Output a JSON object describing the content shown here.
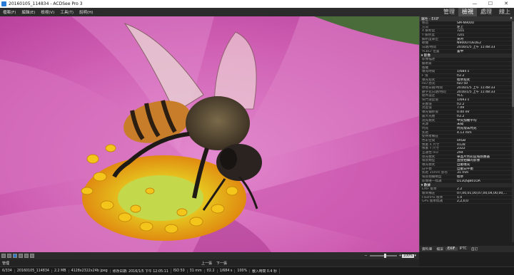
{
  "window": {
    "title": "20160105_114834 - ACDSee Pro 3",
    "min": "—",
    "max": "☐",
    "close": "✕"
  },
  "menu": [
    "檔案(F)",
    "編輯(E)",
    "檢視(V)",
    "工具(T)",
    "說明(H)"
  ],
  "modes": [
    {
      "label": "管理",
      "active": false
    },
    {
      "label": "檢視",
      "active": true
    },
    {
      "label": "處理",
      "active": false
    },
    {
      "label": "線上",
      "active": false
    }
  ],
  "panel": {
    "header": "屬性 - EXIF",
    "close": "✕",
    "rows": [
      {
        "k": "製造",
        "v": "SM-N900U"
      },
      {
        "k": "方向",
        "v": "左上"
      },
      {
        "k": "X 解析度",
        "v": "72/1"
      },
      {
        "k": "Y 解析度",
        "v": "72/1"
      },
      {
        "k": "解析度單位",
        "v": "英吋"
      },
      {
        "k": "軟體",
        "v": "N900UTUEOE2"
      },
      {
        "k": "日期/時間",
        "v": "2016/1/5 上午 11:48:33"
      },
      {
        "k": "YCbCr 位置",
        "v": "置中"
      },
      {
        "sec": "▾ 影像"
      },
      {
        "k": "影像描述",
        "v": ""
      },
      {
        "k": "藝術家",
        "v": ""
      },
      {
        "k": "版權",
        "v": ""
      },
      {
        "k": "曝光時間",
        "v": "1/684 s"
      },
      {
        "k": "F 值",
        "v": "f/2.2"
      },
      {
        "k": "曝光程式",
        "v": "標準程式"
      },
      {
        "k": "ISO 感光",
        "v": "ISO 50"
      },
      {
        "k": "原始日期/時間",
        "v": "2016/1/5 上午 11:48:33"
      },
      {
        "k": "數字化日期/時間",
        "v": "2016/1/5 上午 11:48:33"
      },
      {
        "k": "組件設定",
        "v": "YCC"
      },
      {
        "k": "快門速度值",
        "v": "1/693 s"
      },
      {
        "k": "光圈值",
        "v": "f/2.2"
      },
      {
        "k": "亮度值",
        "v": "7.09"
      },
      {
        "k": "曝光偏移值",
        "v": "0.00 eV"
      },
      {
        "k": "最大光圈",
        "v": "f/2.2"
      },
      {
        "k": "測光模式",
        "v": "中央加權平均"
      },
      {
        "k": "光源",
        "v": "未知"
      },
      {
        "k": "閃光",
        "v": "閃光燈未閃光"
      },
      {
        "k": "焦距",
        "v": "4.13 mm"
      },
      {
        "k": "使用者備註",
        "v": ""
      },
      {
        "k": "色彩空間",
        "v": "sRGB"
      },
      {
        "k": "像素 X 尺寸",
        "v": "4128"
      },
      {
        "k": "像素 Y 尺寸",
        "v": "2322"
      },
      {
        "k": "互通性 IFD",
        "v": "294"
      },
      {
        "k": "感光模式",
        "v": "單晶片色彩區域感應器"
      },
      {
        "k": "場景類型",
        "v": "直接拍攝的影像"
      },
      {
        "k": "曝光模式",
        "v": "自動曝光"
      },
      {
        "k": "白平衡",
        "v": "自動白平衡"
      },
      {
        "k": "焦距 35mm 膠卷",
        "v": "31 mm"
      },
      {
        "k": "場景拍攝類型",
        "v": "標準"
      },
      {
        "k": "影像唯一標識",
        "v": "D13QSJB01OA"
      },
      {
        "sec": "▾ 數據"
      },
      {
        "k": "EXIF 版本",
        "v": "2.2"
      },
      {
        "k": "廠商備註",
        "v": "07,00,01,00,07,00,04,00,00,..."
      },
      {
        "k": "FlashPix 版本",
        "v": "1.0"
      },
      {
        "k": "GPS 版本標識",
        "v": "2,2,0,0"
      }
    ]
  },
  "panel_tabs": [
    {
      "label": "資料庫",
      "active": false
    },
    {
      "label": "檔案",
      "active": false
    },
    {
      "label": "EXIF",
      "active": true
    },
    {
      "label": "IPTC",
      "active": false
    },
    {
      "label": "自訂",
      "active": false
    }
  ],
  "toolbar": {
    "zoom": "100%",
    "fit": "▾"
  },
  "navbar": {
    "back": "管理",
    "prev": "上一張",
    "next": "下一張"
  },
  "status": [
    "6/334",
    "20160105_114834",
    "2.2 MB",
    "4128x2322x24b jpeg",
    "修改日期: 2016/1/5 下午 12:05:11",
    "ISO 50",
    "31 mm",
    "f/2.2",
    "1/684 s",
    "100%",
    "載入時間 0.4 秒"
  ],
  "colors": {
    "accent": "#2f77c8",
    "petal": "#d86bc0",
    "pollen": "#f2c51e"
  }
}
